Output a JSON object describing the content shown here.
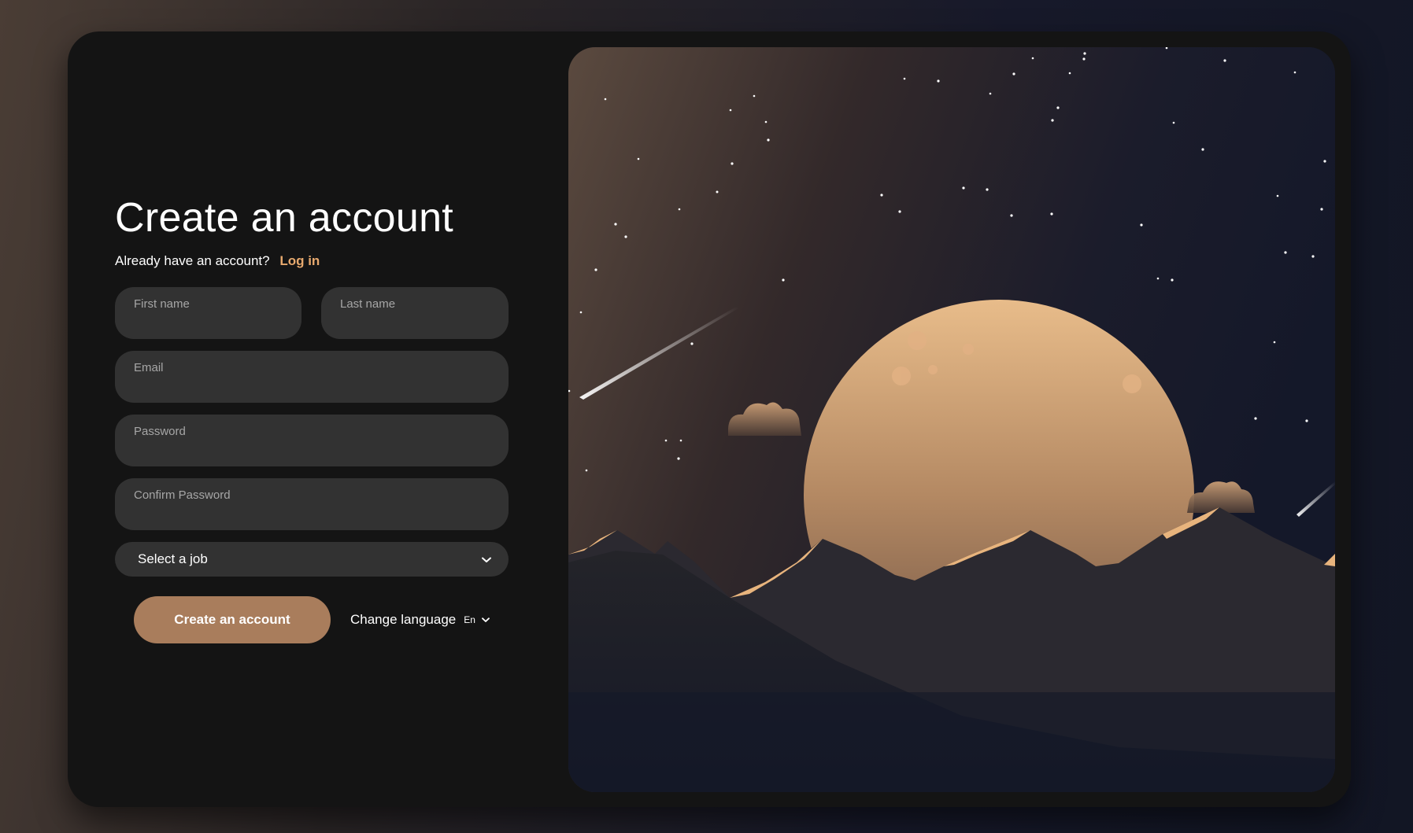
{
  "form": {
    "title": "Create an account",
    "subtitle": "Already have an account?",
    "login_link": "Log in",
    "fields": {
      "first_name": {
        "label": "First name",
        "value": ""
      },
      "last_name": {
        "label": "Last name",
        "value": ""
      },
      "email": {
        "label": "Email",
        "value": ""
      },
      "password": {
        "label": "Password",
        "value": ""
      },
      "confirm_password": {
        "label": "Confirm Password",
        "value": ""
      }
    },
    "job_select": {
      "selected": "Select a job",
      "icon": "chevron-down-icon"
    },
    "submit_label": "Create an account",
    "language": {
      "label": "Change language",
      "code": "En",
      "icon": "chevron-down-icon"
    }
  },
  "colors": {
    "page_background_left": "#4a3d35",
    "page_background_right": "#121624",
    "card_background": "#141414",
    "field_background": "#323232",
    "accent_link": "#e7a96e",
    "button_background": "#a97d5c",
    "moon": "#d8a77a"
  },
  "illustration": {
    "subject": "moon-over-mountains-illustration"
  }
}
